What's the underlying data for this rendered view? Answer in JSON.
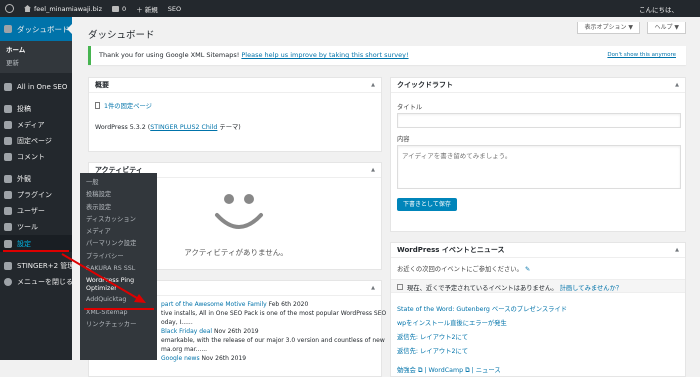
{
  "adminbar": {
    "site_name": "feel_minamiawaji.biz",
    "comment_count": "0",
    "new_label": "＋ 新規",
    "seo_label": "SEO",
    "greeting": "こんにちは、"
  },
  "menu": {
    "dashboard": "ダッシュボード",
    "home": "ホーム",
    "updates": "更新",
    "aioseo": "All in One SEO",
    "posts": "投稿",
    "media": "メディア",
    "pages": "固定ページ",
    "comments": "コメント",
    "appearance": "外観",
    "plugins": "プラグイン",
    "users": "ユーザー",
    "tools": "ツール",
    "settings": "設定",
    "stinger": "STINGER+2 管理",
    "collapse": "メニューを閉じる"
  },
  "flyout": [
    "一般",
    "投稿設定",
    "表示設定",
    "ディスカッション",
    "メディア",
    "パーマリンク設定",
    "プライバシー",
    "SAKURA RS SSL",
    "WordPress Ping Optimizer",
    "AddQuicktag",
    "XML-Sitemap",
    "リンクチェッカー"
  ],
  "page": {
    "title": "ダッシュボード",
    "screen_options": "表示オプション ▼",
    "help": "ヘルプ ▼"
  },
  "notice": {
    "text": "Thank you for using Google XML Sitemaps!",
    "link": "Please help us improve by taking this short survey!",
    "dismiss": "Don't show this anymore"
  },
  "overview": {
    "title": "概要",
    "pages": "1件の固定ページ",
    "version_prefix": "WordPress 5.3.2 (",
    "theme": "STINGER PLUS2 Child",
    "version_suffix": " テーマ)"
  },
  "activity": {
    "title": "アクティビティ",
    "empty": "アクティビティがありません。"
  },
  "news_widget": {
    "items": [
      {
        "title_tail": "part of the Awesome Motive Family",
        "date": "Feb 6th 2020",
        "body": "tive installs, All in One SEO Pack is one of the most popular WordPress SEO",
        "body2": "oday, I......"
      },
      {
        "title_tail": "Black Friday deal",
        "date": "Nov 26th 2019",
        "body": "emarkable, with the release of our major 3.0 version and countless of new",
        "body2": "ma.org mar......"
      },
      {
        "title_tail": "Google news",
        "date": "Nov 26th 2019",
        "body": "",
        "body2": ""
      }
    ]
  },
  "quickdraft": {
    "title": "クイックドラフト",
    "title_label": "タイトル",
    "content_label": "内容",
    "placeholder": "アイディアを書き留めてみましょう。",
    "save": "下書きとして保存"
  },
  "events": {
    "title": "WordPress イベントとニュース",
    "intro": "お近くの次回のイベントにご参加ください。",
    "none_text": "現在、近くで予定されているイベントはありません。",
    "plan_link": "計画してみませんか？",
    "news": [
      "State of the Word: Gutenberg ベースのプレゼンスライド",
      "wpをインストール直後にエラーが発生",
      "返信先: レイアウト2にて",
      "返信先: レイアウト2にて"
    ],
    "footer": [
      "勉強会",
      "WordCamp",
      "ニュース"
    ]
  }
}
